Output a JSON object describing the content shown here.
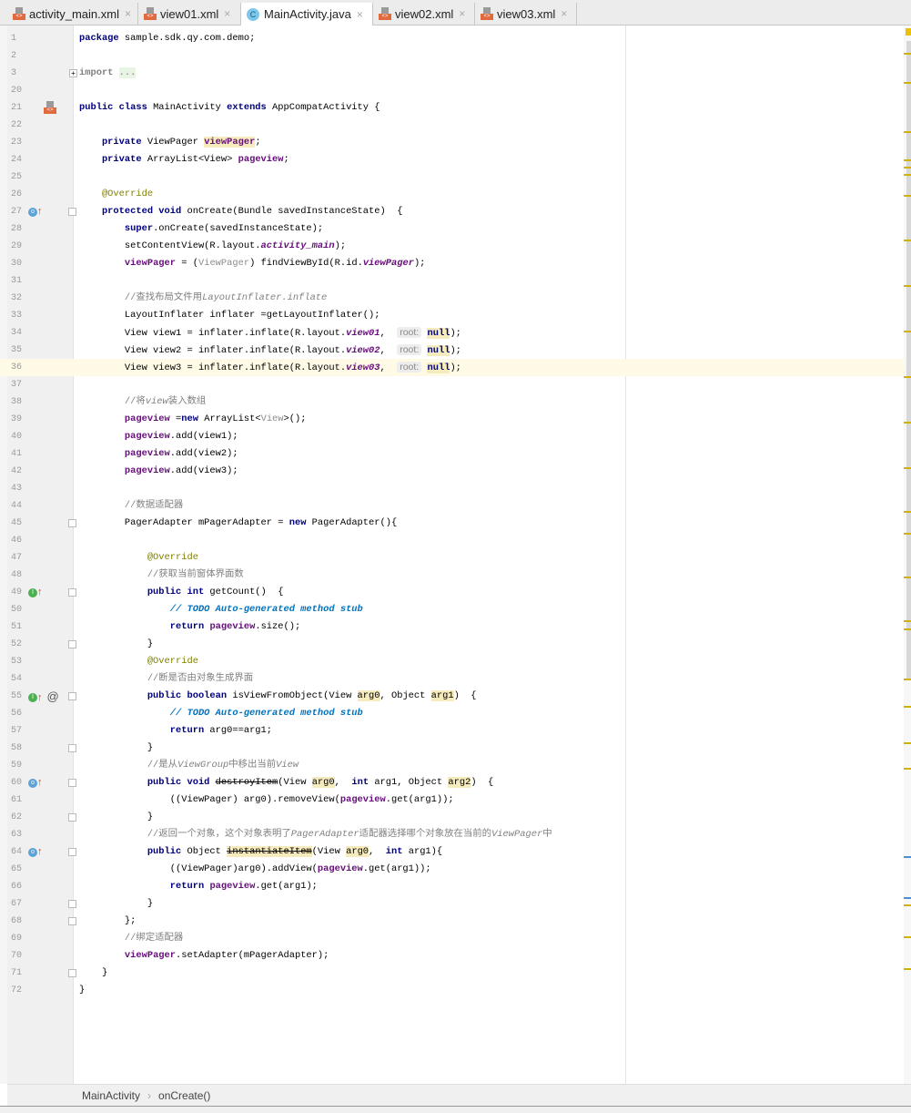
{
  "tabs": [
    {
      "label": "activity_main.xml",
      "icon": "xml-file-icon",
      "active": false
    },
    {
      "label": "view01.xml",
      "icon": "xml-file-icon",
      "active": false
    },
    {
      "label": "MainActivity.java",
      "icon": "java-class-icon",
      "active": true
    },
    {
      "label": "view02.xml",
      "icon": "xml-file-icon",
      "active": false
    },
    {
      "label": "view03.xml",
      "icon": "xml-file-icon",
      "active": false
    }
  ],
  "class_icon_letter": "C",
  "close_glyph": "×",
  "current_line": 36,
  "lines": [
    {
      "n": 1,
      "t": [
        [
          "package",
          "k"
        ],
        [
          " sample.sdk.qy.com.demo;",
          ""
        ]
      ]
    },
    {
      "n": 2,
      "t": []
    },
    {
      "n": 3,
      "t": [
        [
          "import",
          "im"
        ],
        [
          " ",
          ""
        ],
        [
          "...",
          "dots"
        ]
      ],
      "fold": true
    },
    {
      "n": 20,
      "t": []
    },
    {
      "n": 21,
      "t": [
        [
          "public class",
          "k"
        ],
        [
          " MainActivity ",
          ""
        ],
        [
          "extends",
          "k"
        ],
        [
          " AppCompatActivity {",
          ""
        ]
      ],
      "gicon": "xml"
    },
    {
      "n": 22,
      "t": []
    },
    {
      "n": 23,
      "t": [
        [
          "    private",
          "k"
        ],
        [
          " ViewPager ",
          ""
        ],
        [
          "viewPager",
          "f hl"
        ],
        [
          ";",
          ""
        ]
      ]
    },
    {
      "n": 24,
      "t": [
        [
          "    private",
          "k"
        ],
        [
          " ArrayList<View> ",
          ""
        ],
        [
          "pageview",
          "f"
        ],
        [
          ";",
          ""
        ]
      ]
    },
    {
      "n": 25,
      "t": []
    },
    {
      "n": 26,
      "t": [
        [
          "    @Override",
          "a"
        ]
      ]
    },
    {
      "n": 27,
      "t": [
        [
          "    protected void",
          "k"
        ],
        [
          " onCreate(Bundle savedInstanceState)  {",
          ""
        ]
      ],
      "gicon": "o",
      "fold": true
    },
    {
      "n": 28,
      "t": [
        [
          "        super",
          "k"
        ],
        [
          ".onCreate(savedInstanceState);",
          ""
        ]
      ]
    },
    {
      "n": 29,
      "t": [
        [
          "        setContentView(R.layout.",
          ""
        ],
        [
          "activity_main",
          "fi"
        ],
        [
          ");",
          ""
        ]
      ]
    },
    {
      "n": 30,
      "t": [
        [
          "        ",
          ""
        ],
        [
          "viewPager",
          "f"
        ],
        [
          " = (",
          ""
        ],
        [
          "ViewPager",
          "g"
        ],
        [
          ") findViewById(R.id.",
          ""
        ],
        [
          "viewPager",
          "fi"
        ],
        [
          ");",
          ""
        ]
      ]
    },
    {
      "n": 31,
      "t": []
    },
    {
      "n": 32,
      "t": [
        [
          "        //查找布局文件用",
          "c"
        ],
        [
          "LayoutInflater.inflate",
          "ci"
        ]
      ]
    },
    {
      "n": 33,
      "t": [
        [
          "        LayoutInflater inflater =getLayoutInflater();",
          ""
        ]
      ]
    },
    {
      "n": 34,
      "t": [
        [
          "        View view1 = inflater.inflate(R.layout.",
          ""
        ],
        [
          "view01",
          "fi"
        ],
        [
          ",  ",
          ""
        ],
        [
          "root:",
          "h"
        ],
        [
          " ",
          ""
        ],
        [
          "null",
          "k hl"
        ],
        [
          ");",
          ""
        ]
      ]
    },
    {
      "n": 35,
      "t": [
        [
          "        View view2 = inflater.inflate(R.layout.",
          ""
        ],
        [
          "view02",
          "fi"
        ],
        [
          ",  ",
          ""
        ],
        [
          "root:",
          "h"
        ],
        [
          " ",
          ""
        ],
        [
          "null",
          "k hl"
        ],
        [
          ");",
          ""
        ]
      ]
    },
    {
      "n": 36,
      "t": [
        [
          "        View view3 = inflater.inflate(R.layout.",
          ""
        ],
        [
          "view03",
          "fi"
        ],
        [
          ",  ",
          ""
        ],
        [
          "root:",
          "h"
        ],
        [
          " ",
          ""
        ],
        [
          "null",
          "k hl"
        ],
        [
          ");",
          ""
        ]
      ]
    },
    {
      "n": 37,
      "t": []
    },
    {
      "n": 38,
      "t": [
        [
          "        //将",
          "c"
        ],
        [
          "view",
          "ci"
        ],
        [
          "装入数组",
          "c"
        ]
      ]
    },
    {
      "n": 39,
      "t": [
        [
          "        ",
          ""
        ],
        [
          "pageview",
          "f"
        ],
        [
          " =",
          ""
        ],
        [
          "new",
          "k"
        ],
        [
          " ArrayList<",
          ""
        ],
        [
          "View",
          "g"
        ],
        [
          ">();",
          ""
        ]
      ]
    },
    {
      "n": 40,
      "t": [
        [
          "        ",
          ""
        ],
        [
          "pageview",
          "f"
        ],
        [
          ".add(view1);",
          ""
        ]
      ]
    },
    {
      "n": 41,
      "t": [
        [
          "        ",
          ""
        ],
        [
          "pageview",
          "f"
        ],
        [
          ".add(view2);",
          ""
        ]
      ]
    },
    {
      "n": 42,
      "t": [
        [
          "        ",
          ""
        ],
        [
          "pageview",
          "f"
        ],
        [
          ".add(view3);",
          ""
        ]
      ]
    },
    {
      "n": 43,
      "t": []
    },
    {
      "n": 44,
      "t": [
        [
          "        //数据适配器",
          "c"
        ]
      ]
    },
    {
      "n": 45,
      "t": [
        [
          "        PagerAdapter mPagerAdapter = ",
          ""
        ],
        [
          "new",
          "k"
        ],
        [
          " PagerAdapter(){",
          ""
        ]
      ],
      "fold": true
    },
    {
      "n": 46,
      "t": []
    },
    {
      "n": 47,
      "t": [
        [
          "            @Override",
          "a"
        ]
      ]
    },
    {
      "n": 48,
      "t": [
        [
          "            //获取当前窗体界面数",
          "c"
        ]
      ]
    },
    {
      "n": 49,
      "t": [
        [
          "            public int",
          "k"
        ],
        [
          " getCount()  {",
          ""
        ]
      ],
      "gicon": "i",
      "fold": true
    },
    {
      "n": 50,
      "t": [
        [
          "                // TODO Auto-generated method stub",
          "todo"
        ]
      ]
    },
    {
      "n": 51,
      "t": [
        [
          "                return",
          "k"
        ],
        [
          " ",
          ""
        ],
        [
          "pageview",
          "f"
        ],
        [
          ".size();",
          ""
        ]
      ]
    },
    {
      "n": 52,
      "t": [
        [
          "            }",
          ""
        ]
      ],
      "fold": true
    },
    {
      "n": 53,
      "t": [
        [
          "            @Override",
          "a"
        ]
      ]
    },
    {
      "n": 54,
      "t": [
        [
          "            //断是否由对象生成界面",
          "c"
        ]
      ]
    },
    {
      "n": 55,
      "t": [
        [
          "            public boolean",
          "k"
        ],
        [
          " isViewFromObject(View ",
          ""
        ],
        [
          "arg0",
          "hl"
        ],
        [
          ", Object ",
          ""
        ],
        [
          "arg1",
          "hl"
        ],
        [
          ")  {",
          ""
        ]
      ],
      "gicon": "i@",
      "fold": true
    },
    {
      "n": 56,
      "t": [
        [
          "                // TODO Auto-generated method stub",
          "todo"
        ]
      ]
    },
    {
      "n": 57,
      "t": [
        [
          "                return",
          "k"
        ],
        [
          " arg0==arg1;",
          ""
        ]
      ]
    },
    {
      "n": 58,
      "t": [
        [
          "            }",
          ""
        ]
      ],
      "fold": true
    },
    {
      "n": 59,
      "t": [
        [
          "            //是从",
          "c"
        ],
        [
          "ViewGroup",
          "ci"
        ],
        [
          "中移出当前",
          "c"
        ],
        [
          "View",
          "ci"
        ]
      ]
    },
    {
      "n": 60,
      "t": [
        [
          "            public void",
          "k"
        ],
        [
          " ",
          ""
        ],
        [
          "destroyItem",
          "st"
        ],
        [
          "(View ",
          ""
        ],
        [
          "arg0",
          "hl"
        ],
        [
          ",  ",
          ""
        ],
        [
          "int",
          "k"
        ],
        [
          " arg1, Object ",
          ""
        ],
        [
          "arg2",
          "hl"
        ],
        [
          ")  {",
          ""
        ]
      ],
      "gicon": "o",
      "fold": true
    },
    {
      "n": 61,
      "t": [
        [
          "                ((ViewPager) arg0).removeView(",
          ""
        ],
        [
          "pageview",
          "f"
        ],
        [
          ".get(arg1));",
          ""
        ]
      ]
    },
    {
      "n": 62,
      "t": [
        [
          "            }",
          ""
        ]
      ],
      "fold": true
    },
    {
      "n": 63,
      "t": [
        [
          "            //返回一个对象，这个对象表明了",
          "c"
        ],
        [
          "PagerAdapter",
          "ci"
        ],
        [
          "适配器选择哪个对象放在当前的",
          "c"
        ],
        [
          "ViewPager",
          "ci"
        ],
        [
          "中",
          "c"
        ]
      ]
    },
    {
      "n": 64,
      "t": [
        [
          "            public",
          "k"
        ],
        [
          " Object ",
          ""
        ],
        [
          "instantiateItem",
          "st hl"
        ],
        [
          "(View ",
          ""
        ],
        [
          "arg0",
          "hl"
        ],
        [
          ",  ",
          ""
        ],
        [
          "int",
          "k"
        ],
        [
          " arg1){",
          ""
        ]
      ],
      "gicon": "o",
      "fold": true
    },
    {
      "n": 65,
      "t": [
        [
          "                ((ViewPager)arg0).addView(",
          ""
        ],
        [
          "pageview",
          "f"
        ],
        [
          ".get(arg1));",
          ""
        ]
      ]
    },
    {
      "n": 66,
      "t": [
        [
          "                return",
          "k"
        ],
        [
          " ",
          ""
        ],
        [
          "pageview",
          "f"
        ],
        [
          ".get(arg1);",
          ""
        ]
      ]
    },
    {
      "n": 67,
      "t": [
        [
          "            }",
          ""
        ]
      ],
      "fold": true
    },
    {
      "n": 68,
      "t": [
        [
          "        };",
          ""
        ]
      ],
      "fold": true
    },
    {
      "n": 69,
      "t": [
        [
          "        //绑定适配器",
          "c"
        ]
      ]
    },
    {
      "n": 70,
      "t": [
        [
          "        ",
          ""
        ],
        [
          "viewPager",
          "f"
        ],
        [
          ".setAdapter(mPagerAdapter);",
          ""
        ]
      ]
    },
    {
      "n": 71,
      "t": [
        [
          "    }",
          ""
        ]
      ],
      "fold": true
    },
    {
      "n": 72,
      "t": [
        [
          "}",
          ""
        ]
      ]
    }
  ],
  "breadcrumb": {
    "items": [
      "MainActivity",
      "onCreate()"
    ],
    "separator": "›"
  },
  "colors": {
    "current_line": "#fefae6",
    "keyword": "#000080",
    "field": "#660e7a",
    "todo": "#0073bf",
    "marker": "#d6b000"
  }
}
